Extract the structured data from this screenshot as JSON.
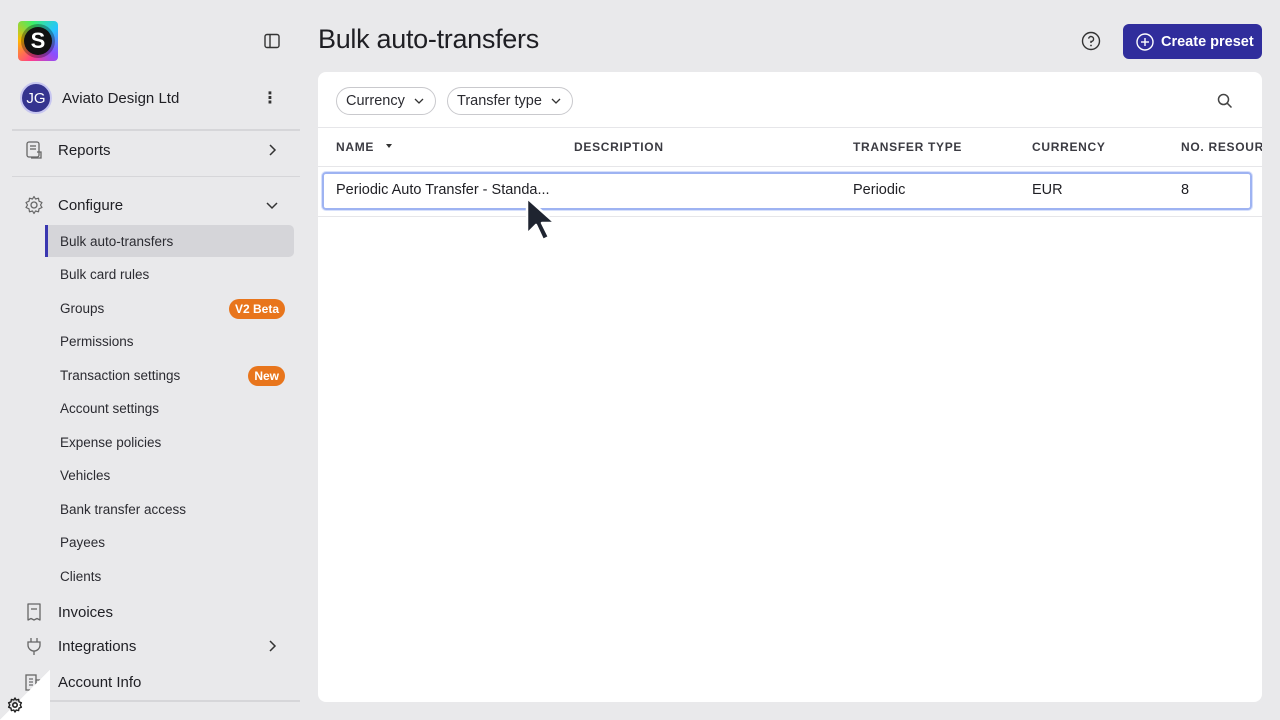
{
  "page": {
    "title": "Bulk auto-transfers",
    "create_label": "Create preset"
  },
  "sidebar": {
    "logo_letter": "S",
    "org": {
      "initials": "JG",
      "name": "Aviato Design Ltd"
    },
    "reports_label": "Reports",
    "configure_label": "Configure",
    "config_items": [
      {
        "label": "Bulk auto-transfers"
      },
      {
        "label": "Bulk card rules"
      },
      {
        "label": "Groups",
        "badge": "V2 Beta"
      },
      {
        "label": "Permissions"
      },
      {
        "label": "Transaction settings",
        "badge": "New"
      },
      {
        "label": "Account settings"
      },
      {
        "label": "Expense policies"
      },
      {
        "label": "Vehicles"
      },
      {
        "label": "Bank transfer access"
      },
      {
        "label": "Payees"
      },
      {
        "label": "Clients"
      }
    ],
    "invoices_label": "Invoices",
    "integrations_label": "Integrations",
    "account_info_label": "Account Info"
  },
  "filters": {
    "currency": "Currency",
    "transfer_type": "Transfer type"
  },
  "table": {
    "columns": [
      "NAME",
      "DESCRIPTION",
      "TRANSFER TYPE",
      "CURRENCY",
      "NO. RESOURCES"
    ],
    "rows": [
      {
        "name": "Periodic Auto Transfer - Standa...",
        "description": "",
        "transfer_type": "Periodic",
        "currency": "EUR",
        "resources": "8"
      }
    ]
  },
  "colors": {
    "accent": "#302d9c",
    "badge": "#e8751c",
    "active_indicator": "#3a37b0",
    "row_highlight": "#9eb3f2"
  }
}
